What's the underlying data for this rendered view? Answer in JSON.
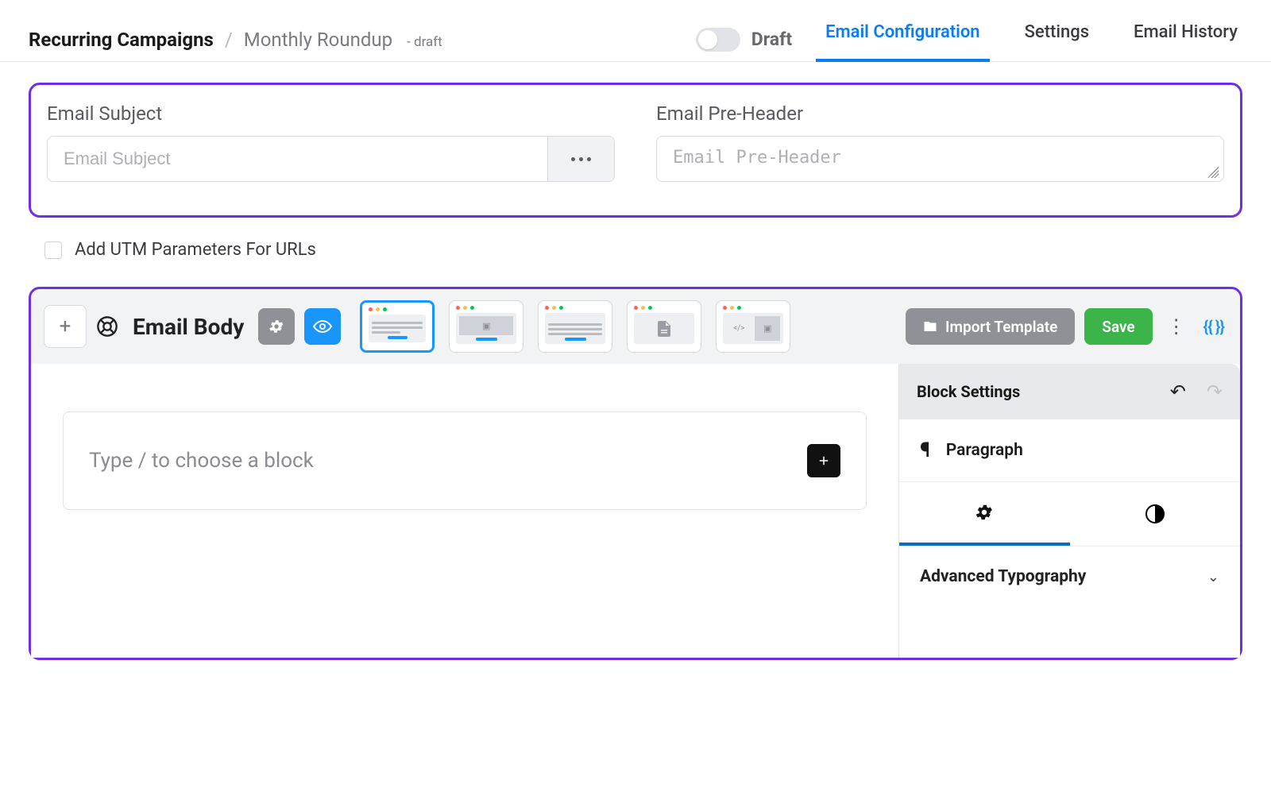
{
  "breadcrumb": {
    "root": "Recurring Campaigns",
    "sep": "/",
    "name": "Monthly Roundup",
    "suffix": "- draft"
  },
  "draft_toggle_label": "Draft",
  "tabs": [
    {
      "label": "Email Configuration",
      "active": true
    },
    {
      "label": "Settings",
      "active": false
    },
    {
      "label": "Email History",
      "active": false
    }
  ],
  "fields": {
    "subject_label": "Email Subject",
    "subject_placeholder": "Email Subject",
    "preheader_label": "Email Pre-Header",
    "preheader_placeholder": "Email Pre-Header"
  },
  "utm_label": "Add UTM Parameters For URLs",
  "body": {
    "title": "Email Body",
    "import_template": "Import Template",
    "save": "Save",
    "braces": "{{ }}",
    "placeholder": "Type / to choose a block"
  },
  "inspector": {
    "title": "Block Settings",
    "block_type": "Paragraph",
    "accordion1": "Advanced Typography"
  }
}
